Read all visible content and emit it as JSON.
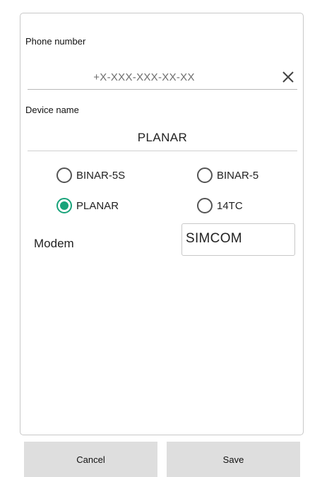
{
  "form": {
    "phone": {
      "label": "Phone number",
      "value": "",
      "placeholder": "+X-XXX-XXX-XX-XX",
      "clear_icon": "close-icon"
    },
    "device": {
      "label": "Device name",
      "value": "PLANAR"
    },
    "device_types": [
      {
        "label": "BINAR-5S",
        "checked": false
      },
      {
        "label": "BINAR-5",
        "checked": false
      },
      {
        "label": "PLANAR",
        "checked": true
      },
      {
        "label": "14TC",
        "checked": false
      }
    ],
    "modem": {
      "label": "Modem",
      "value": "SIMCOM"
    }
  },
  "actions": {
    "cancel_label": "Cancel",
    "save_label": "Save"
  },
  "colors": {
    "accent": "#18a37a",
    "button_bg": "#dedede",
    "border": "#c8c8c8"
  }
}
